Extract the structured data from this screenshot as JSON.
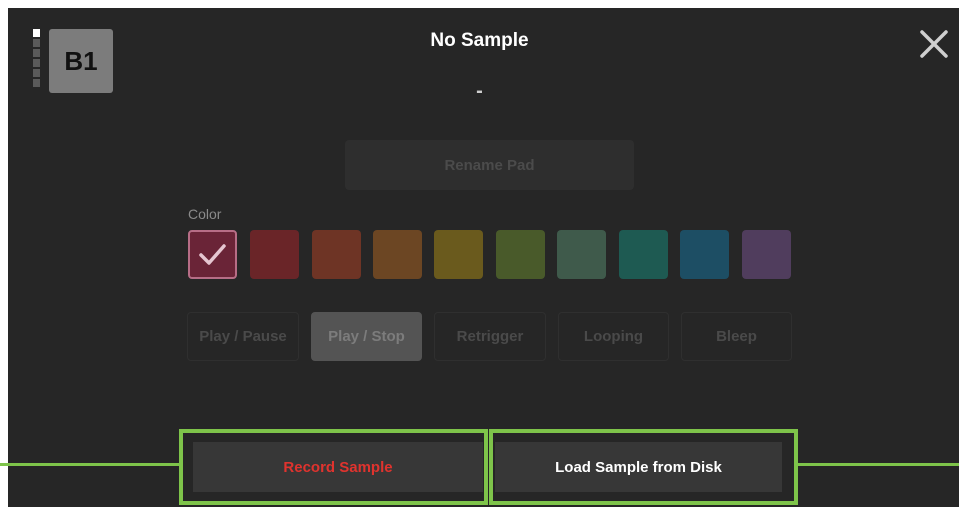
{
  "bank_indicator": {
    "count": 6,
    "active_index": 0
  },
  "pad": {
    "id": "B1"
  },
  "header": {
    "title": "No Sample",
    "subtitle": "-"
  },
  "close_icon": "close-icon",
  "rename_button": "Rename Pad",
  "color_section": {
    "label": "Color",
    "swatches": [
      "#6a2437",
      "#6a2528",
      "#6e3425",
      "#6c4623",
      "#6a5a1d",
      "#495a2a",
      "#3f5a4b",
      "#1e5a52",
      "#1d4e64",
      "#503d5d"
    ],
    "selected_index": 0
  },
  "modes": [
    {
      "label": "Play / Pause",
      "active": false
    },
    {
      "label": "Play / Stop",
      "active": true
    },
    {
      "label": "Retrigger",
      "active": false
    },
    {
      "label": "Looping",
      "active": false
    },
    {
      "label": "Bleep",
      "active": false
    }
  ],
  "footer": {
    "record_label": "Record Sample",
    "load_label": "Load Sample from Disk",
    "record_color": "#e0332e",
    "highlight_color": "#7ec44a"
  }
}
